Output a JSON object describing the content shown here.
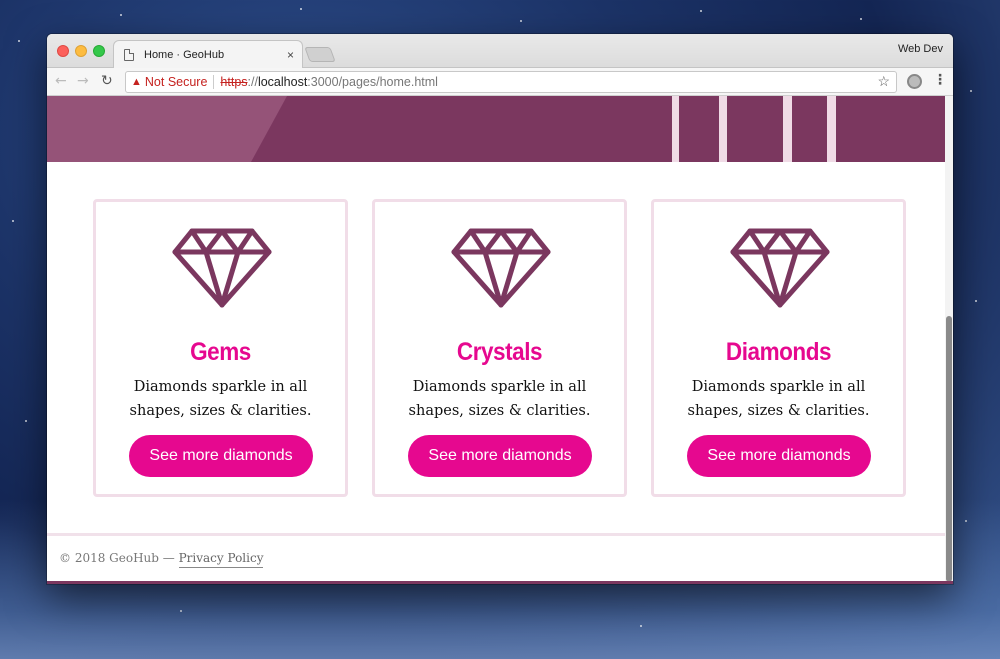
{
  "browser": {
    "tab_title": "Home · GeoHub",
    "tab_close": "×",
    "profile_name": "Web Dev",
    "security_label": "Not Secure",
    "url_scheme": "https",
    "url_sep": "://",
    "url_host": "localhost",
    "url_path": ":3000/pages/home.html",
    "icons": {
      "back": "back-arrow-icon",
      "forward": "forward-arrow-icon",
      "reload": "reload-icon",
      "warning": "warning-icon",
      "bookmark": "star-icon",
      "extension": "extension-icon",
      "menu": "kebab-menu-icon"
    }
  },
  "colors": {
    "hero": "#7b375f",
    "accent": "#e6088f",
    "card_border": "#f1dde8",
    "gem_stroke": "#7b375f"
  },
  "cards": [
    {
      "title": "Gems",
      "text": "Diamonds sparkle in all shapes, sizes & clarities.",
      "button": "See more diamonds",
      "icon": "diamond-icon"
    },
    {
      "title": "Crystals",
      "text": "Diamonds sparkle in all shapes, sizes & clarities.",
      "button": "See more diamonds",
      "icon": "diamond-icon"
    },
    {
      "title": "Diamonds",
      "text": "Diamonds sparkle in all shapes, sizes & clarities.",
      "button": "See more diamonds",
      "icon": "diamond-icon"
    }
  ],
  "footer": {
    "copyright": "© 2018 GeoHub — ",
    "privacy_link": "Privacy Policy"
  }
}
